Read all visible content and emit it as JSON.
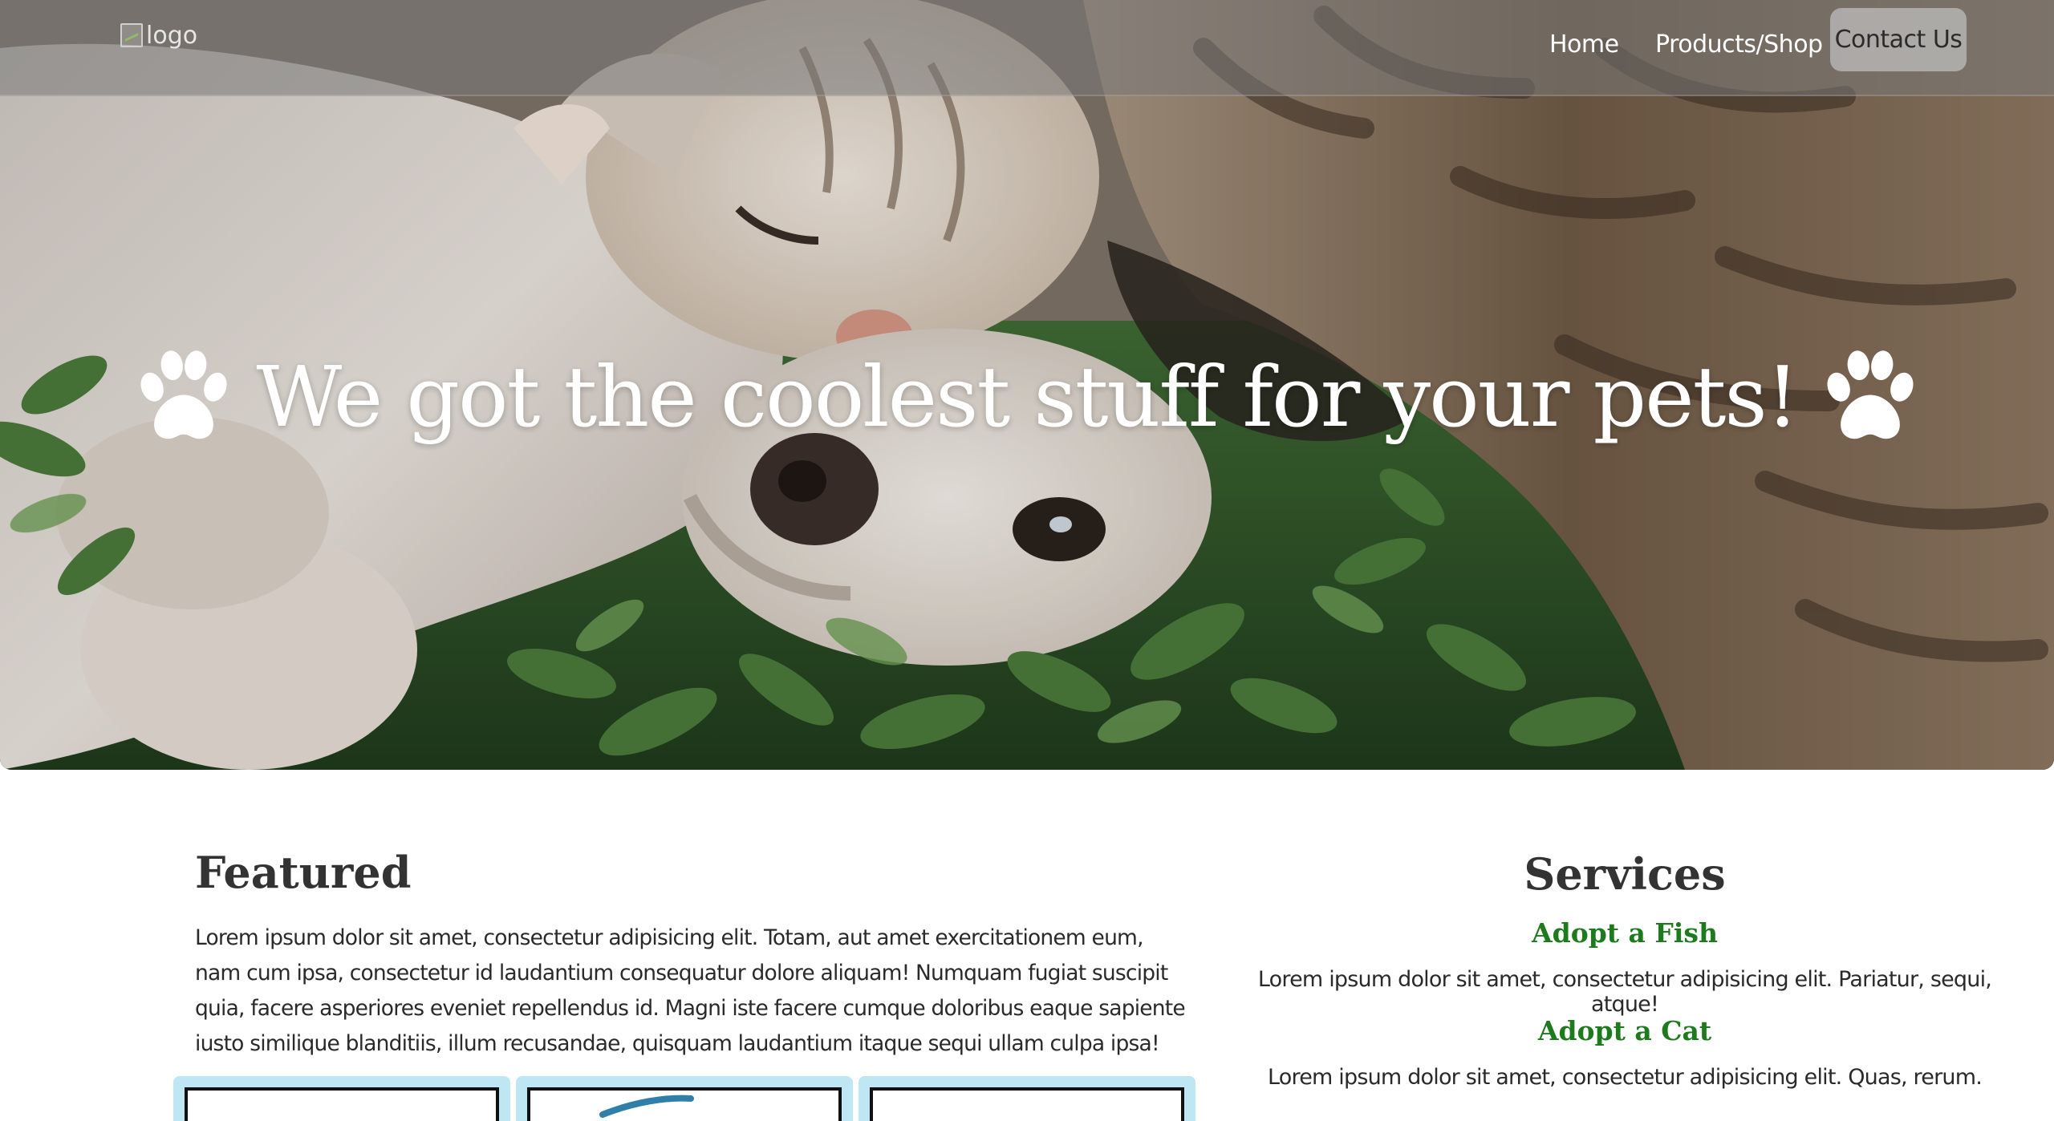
{
  "nav": {
    "logo_alt": "logo",
    "links": [
      "Home",
      "Products/Shop"
    ],
    "contact_label": "Contact Us"
  },
  "hero": {
    "headline": "We got the coolest stuff for your pets!",
    "icon": "paw-icon"
  },
  "featured": {
    "title": "Featured",
    "body": "Lorem ipsum dolor sit amet, consectetur adipisicing elit. Totam, aut amet exercitationem eum, nam cum ipsa, consectetur id laudantium consequatur dolore aliquam! Numquam fugiat suscipit quia, facere asperiores eveniet repellendus id. Magni iste facere cumque doloribus eaque sapiente iusto similique blanditiis, illum recusandae, quisquam laudantium itaque sequi ullam culpa ipsa!"
  },
  "services": {
    "title": "Services",
    "items": [
      {
        "heading": "Adopt a Fish",
        "text": "Lorem ipsum dolor sit amet, consectetur adipisicing elit. Pariatur, sequi, atque!"
      },
      {
        "heading": "Adopt a Cat",
        "text": "Lorem ipsum dolor sit amet, consectetur adipisicing elit. Quas, rerum."
      }
    ]
  },
  "colors": {
    "service_heading": "#1d7a1d",
    "card_border": "#bfe6f3",
    "navbar_overlay": "rgba(120,120,120,0.55)"
  }
}
